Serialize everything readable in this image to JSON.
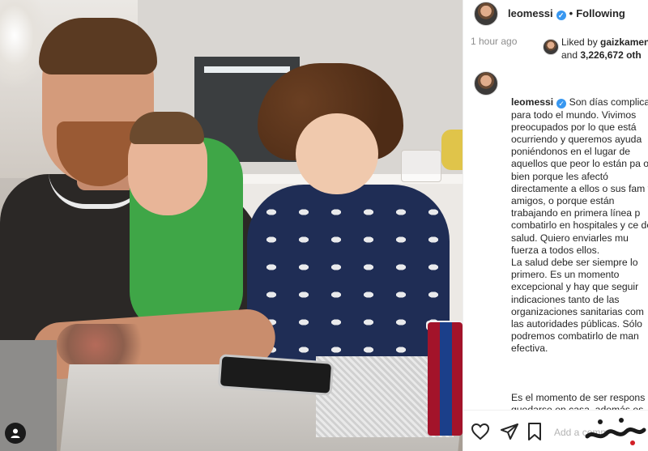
{
  "post": {
    "username": "leomessi",
    "follow_status": "Following",
    "time_ago": "1 hour ago",
    "liked_by_prefix": "Liked by ",
    "liked_by_user": "gaizkamen",
    "liked_by_and": "and ",
    "liked_by_count": "3,226,672 oth",
    "caption_user": "leomessi",
    "caption_p1": "Son días complica para todo el mundo. Vivimos preocupados por lo que está ocurriendo y queremos ayuda poniéndonos en el lugar de aquellos que peor lo están pa o bien porque les afectó directamente a ellos o sus fam y amigos, o porque están trabajando en primera línea p combatirlo en hospitales y ce de salud. Quiero enviarles mu fuerza a todos ellos.\nLa salud debe ser siempre lo primero. Es un momento excepcional y hay que seguir indicaciones tanto de las organizaciones sanitarias com las autoridades públicas. Sólo podremos combatirlo de man efectiva.",
    "caption_p2": "Es el momento de ser respons quedarse en casa, además es perfecto para disfrutar ese tie",
    "add_comment_placeholder": "Add a comm"
  },
  "icons": {
    "verified": "verified-badge-icon",
    "heart": "heart-icon",
    "share": "share-icon",
    "bookmark": "bookmark-icon",
    "tagged_user": "user-tag-icon",
    "watermark": "site-watermark-logo"
  },
  "colors": {
    "verified_blue": "#3897f0",
    "secondary_text": "#8e8e8e"
  }
}
